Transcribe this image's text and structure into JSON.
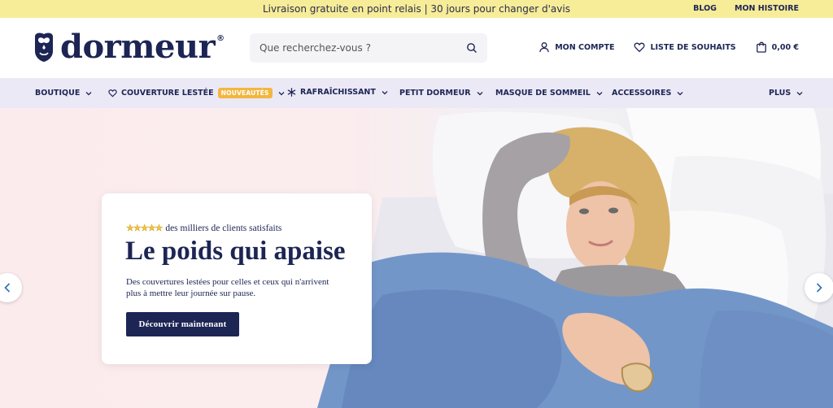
{
  "topbar": {
    "announcement": "Livraison gratuite en point relais | 30 jours pour changer d'avis",
    "links": [
      "BLOG",
      "MON HISTOIRE"
    ]
  },
  "header": {
    "logo_text": "dormeur",
    "logo_mark": "®",
    "search_placeholder": "Que recherchez-vous ?",
    "account_label": "MON COMPTE",
    "wishlist_label": "LISTE DE SOUHAITS",
    "cart_total": "0,00 €"
  },
  "nav": {
    "items": [
      {
        "label": "BOUTIQUE"
      },
      {
        "label": "COUVERTURE LESTÉE",
        "badge": "NOUVEAUTÉS"
      },
      {
        "label": "RAFRAÎCHISSANT"
      },
      {
        "label": "PETIT DORMEUR"
      },
      {
        "label": "MASQUE DE SOMMEIL"
      },
      {
        "label": "ACCESSOIRES"
      },
      {
        "label": "PLUS"
      }
    ]
  },
  "hero": {
    "stars": "★★★★★",
    "rating_text": "des milliers de clients satisfaits",
    "title": "Le poids qui apaise",
    "description": "Des couvertures lestées pour celles et ceux qui n'arrivent plus à mettre leur journée sur pause.",
    "cta_label": "Découvrir maintenant"
  },
  "colors": {
    "brand_navy": "#1d2554",
    "topbar_yellow": "#f7ec98",
    "nav_lavender": "#ebe9f6",
    "badge_orange": "#f3b63f",
    "hero_pink": "#fbebed"
  },
  "icons": [
    "owl-logo-icon",
    "search-icon",
    "user-icon",
    "heart-icon",
    "cart-icon",
    "chevron-down-icon",
    "snowflake-icon",
    "chevron-left-icon",
    "chevron-right-icon"
  ]
}
